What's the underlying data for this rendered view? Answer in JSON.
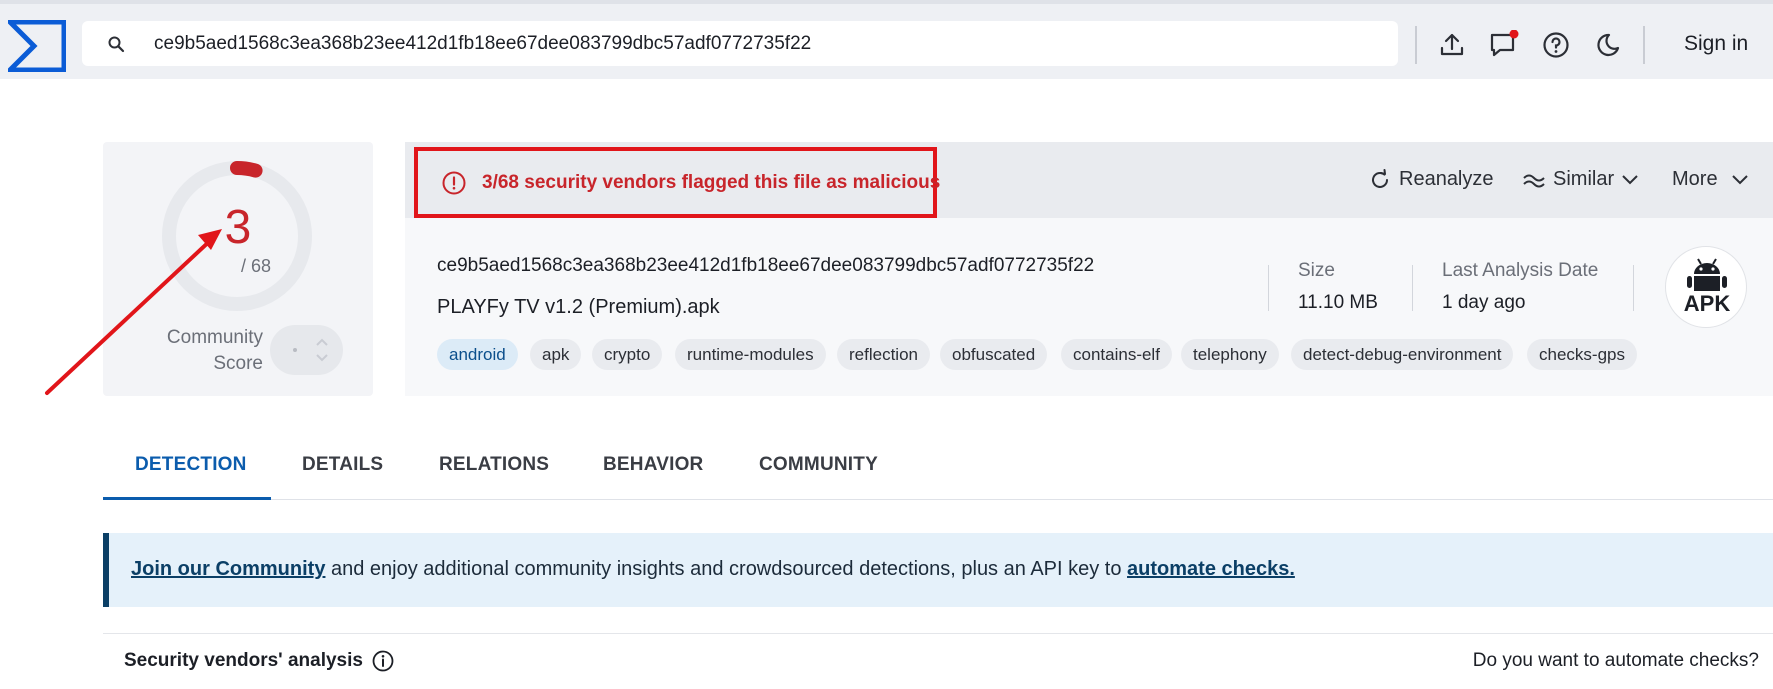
{
  "header": {
    "search_value": "ce9b5aed1568c3ea368b23ee412d1fb18ee67dee083799dbc57adf0772735f22",
    "sign_in_label": "Sign in",
    "icons": [
      "upload-icon",
      "notifications-icon",
      "help-icon",
      "dark-mode-icon"
    ]
  },
  "score": {
    "detections": "3",
    "total": "/ 68",
    "community_label": "Community Score",
    "detection_fraction": 0.044
  },
  "alert": {
    "text": "3/68 security vendors flagged this file as malicious"
  },
  "actions": {
    "reanalyze": "Reanalyze",
    "similar": "Similar",
    "more": "More"
  },
  "file": {
    "hash": "ce9b5aed1568c3ea368b23ee412d1fb18ee67dee083799dbc57adf0772735f22",
    "name": "PLAYFy TV v1.2 (Premium).apk",
    "size_label": "Size",
    "size_value": "11.10 MB",
    "date_label": "Last Analysis Date",
    "date_value": "1 day ago",
    "type_badge": "APK"
  },
  "tags": [
    "android",
    "apk",
    "crypto",
    "runtime-modules",
    "reflection",
    "obfuscated",
    "contains-elf",
    "telephony",
    "detect-debug-environment",
    "checks-gps"
  ],
  "tabs": [
    "DETECTION",
    "DETAILS",
    "RELATIONS",
    "BEHAVIOR",
    "COMMUNITY"
  ],
  "banner": {
    "link1": "Join our Community",
    "middle": " and enjoy additional community insights and crowdsourced detections, plus an API key to ",
    "link2": "automate checks."
  },
  "footer": {
    "vendors_title": "Security vendors' analysis",
    "automate_question": "Do you want to automate checks?"
  },
  "colors": {
    "alert_red": "#c8252b",
    "annotation_red": "#e1151a",
    "accent_blue": "#0b5cad",
    "logo_blue": "#0b5cd6"
  }
}
